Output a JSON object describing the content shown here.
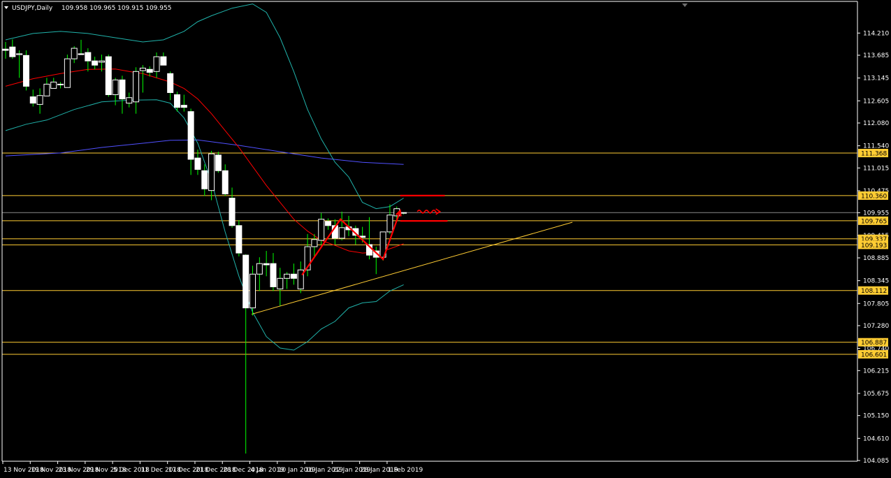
{
  "chart_data": {
    "type": "candlestick",
    "symbol": "USDJPY",
    "timeframe": "Daily",
    "header": {
      "text": "USDJPY,Daily",
      "ohlc": "109.958 109.965 109.915 109.955"
    },
    "ylim": [
      104.085,
      114.48
    ],
    "yticks": [
      "114.210",
      "113.685",
      "113.145",
      "112.605",
      "112.080",
      "111.540",
      "111.015",
      "110.475",
      "109.955",
      "109.415",
      "108.885",
      "108.345",
      "107.805",
      "107.280",
      "106.740",
      "106.215",
      "105.675",
      "105.150",
      "104.610",
      "104.085"
    ],
    "xticks": [
      {
        "i": 0,
        "label": "13 Nov 2018"
      },
      {
        "i": 4,
        "label": "19 Nov 2018"
      },
      {
        "i": 8,
        "label": "23 Nov 2018"
      },
      {
        "i": 12,
        "label": "29 Nov 2018"
      },
      {
        "i": 16,
        "label": "5 Dec 2018"
      },
      {
        "i": 20,
        "label": "11 Dec 2018"
      },
      {
        "i": 24,
        "label": "17 Dec 2018"
      },
      {
        "i": 28,
        "label": "21 Dec 2018"
      },
      {
        "i": 32,
        "label": "28 Dec 2018"
      },
      {
        "i": 36,
        "label": "4 Jan 2019"
      },
      {
        "i": 40,
        "label": "10 Jan 2019"
      },
      {
        "i": 44,
        "label": "16 Jan 2019"
      },
      {
        "i": 48,
        "label": "22 Jan 2019"
      },
      {
        "i": 52,
        "label": "28 Jan 2019"
      },
      {
        "i": 56,
        "label": "1 Feb 2019"
      }
    ],
    "candles": [
      {
        "o": 113.83,
        "h": 114.0,
        "l": 113.6,
        "c": 113.8
      },
      {
        "o": 113.88,
        "h": 114.06,
        "l": 113.6,
        "c": 113.65
      },
      {
        "o": 113.7,
        "h": 113.8,
        "l": 113.15,
        "c": 113.72
      },
      {
        "o": 113.68,
        "h": 113.8,
        "l": 112.85,
        "c": 112.95
      },
      {
        "o": 112.7,
        "h": 112.87,
        "l": 112.47,
        "c": 112.55
      },
      {
        "o": 112.52,
        "h": 112.9,
        "l": 112.3,
        "c": 112.73
      },
      {
        "o": 112.72,
        "h": 113.15,
        "l": 112.72,
        "c": 113.0
      },
      {
        "o": 112.9,
        "h": 113.15,
        "l": 112.9,
        "c": 113.05
      },
      {
        "o": 113.0,
        "h": 113.05,
        "l": 112.9,
        "c": 113.0
      },
      {
        "o": 112.92,
        "h": 113.7,
        "l": 112.92,
        "c": 113.6
      },
      {
        "o": 113.6,
        "h": 113.9,
        "l": 113.5,
        "c": 113.85
      },
      {
        "o": 113.72,
        "h": 114.05,
        "l": 113.7,
        "c": 113.7
      },
      {
        "o": 113.75,
        "h": 113.85,
        "l": 113.3,
        "c": 113.55
      },
      {
        "o": 113.55,
        "h": 113.65,
        "l": 113.35,
        "c": 113.45
      },
      {
        "o": 113.52,
        "h": 113.7,
        "l": 113.3,
        "c": 113.55
      },
      {
        "o": 113.65,
        "h": 113.7,
        "l": 112.7,
        "c": 112.75
      },
      {
        "o": 112.75,
        "h": 113.15,
        "l": 112.5,
        "c": 113.1
      },
      {
        "o": 113.1,
        "h": 113.2,
        "l": 112.3,
        "c": 112.65
      },
      {
        "o": 112.55,
        "h": 112.8,
        "l": 112.45,
        "c": 112.68
      },
      {
        "o": 112.58,
        "h": 113.4,
        "l": 112.3,
        "c": 113.3
      },
      {
        "o": 113.32,
        "h": 113.45,
        "l": 112.8,
        "c": 113.38
      },
      {
        "o": 113.35,
        "h": 113.42,
        "l": 113.18,
        "c": 113.28
      },
      {
        "o": 113.3,
        "h": 113.75,
        "l": 113.15,
        "c": 113.65
      },
      {
        "o": 113.65,
        "h": 113.75,
        "l": 113.45,
        "c": 113.45
      },
      {
        "o": 113.25,
        "h": 113.3,
        "l": 112.62,
        "c": 112.8
      },
      {
        "o": 112.75,
        "h": 112.82,
        "l": 112.35,
        "c": 112.45
      },
      {
        "o": 112.5,
        "h": 112.75,
        "l": 112.35,
        "c": 112.45
      },
      {
        "o": 112.35,
        "h": 112.42,
        "l": 110.85,
        "c": 111.22
      },
      {
        "o": 111.25,
        "h": 111.45,
        "l": 110.85,
        "c": 110.98
      },
      {
        "o": 110.95,
        "h": 111.1,
        "l": 110.35,
        "c": 110.52
      },
      {
        "o": 110.48,
        "h": 111.42,
        "l": 110.25,
        "c": 111.35
      },
      {
        "o": 111.32,
        "h": 111.4,
        "l": 110.9,
        "c": 110.95
      },
      {
        "o": 110.95,
        "h": 111.1,
        "l": 110.35,
        "c": 110.4
      },
      {
        "o": 110.3,
        "h": 110.55,
        "l": 109.6,
        "c": 109.65
      },
      {
        "o": 109.65,
        "h": 109.78,
        "l": 108.92,
        "c": 109.0
      },
      {
        "o": 108.95,
        "h": 108.97,
        "l": 104.25,
        "c": 107.7
      },
      {
        "o": 107.7,
        "h": 108.7,
        "l": 107.52,
        "c": 108.5
      },
      {
        "o": 108.5,
        "h": 108.9,
        "l": 108.1,
        "c": 108.75
      },
      {
        "o": 108.75,
        "h": 109.05,
        "l": 108.45,
        "c": 108.72
      },
      {
        "o": 108.75,
        "h": 109.0,
        "l": 108.1,
        "c": 108.2
      },
      {
        "o": 108.15,
        "h": 108.65,
        "l": 107.75,
        "c": 108.4
      },
      {
        "o": 108.4,
        "h": 108.55,
        "l": 108.15,
        "c": 108.5
      },
      {
        "o": 108.5,
        "h": 108.75,
        "l": 108.25,
        "c": 108.4
      },
      {
        "o": 108.15,
        "h": 108.8,
        "l": 108.05,
        "c": 108.6
      },
      {
        "o": 108.6,
        "h": 109.45,
        "l": 108.45,
        "c": 109.15
      },
      {
        "o": 109.15,
        "h": 109.45,
        "l": 108.9,
        "c": 109.32
      },
      {
        "o": 109.3,
        "h": 109.95,
        "l": 109.2,
        "c": 109.8
      },
      {
        "o": 109.75,
        "h": 109.82,
        "l": 109.55,
        "c": 109.65
      },
      {
        "o": 109.65,
        "h": 109.8,
        "l": 109.2,
        "c": 109.35
      },
      {
        "o": 109.35,
        "h": 109.98,
        "l": 109.3,
        "c": 109.6
      },
      {
        "o": 109.62,
        "h": 109.88,
        "l": 109.4,
        "c": 109.55
      },
      {
        "o": 109.58,
        "h": 109.65,
        "l": 109.2,
        "c": 109.42
      },
      {
        "o": 109.4,
        "h": 109.62,
        "l": 109.25,
        "c": 109.37
      },
      {
        "o": 109.2,
        "h": 109.85,
        "l": 108.85,
        "c": 108.95
      },
      {
        "o": 109.05,
        "h": 109.15,
        "l": 108.5,
        "c": 108.9
      },
      {
        "o": 108.9,
        "h": 109.5,
        "l": 108.82,
        "c": 109.5
      },
      {
        "o": 109.5,
        "h": 110.15,
        "l": 109.45,
        "c": 109.9
      },
      {
        "o": 109.88,
        "h": 110.1,
        "l": 109.75,
        "c": 110.05
      },
      {
        "o": 109.958,
        "h": 109.965,
        "l": 109.915,
        "c": 109.955
      }
    ],
    "upper_band": [
      {
        "i": 0,
        "v": 114.05
      },
      {
        "i": 4,
        "v": 114.2
      },
      {
        "i": 8,
        "v": 114.25
      },
      {
        "i": 12,
        "v": 114.2
      },
      {
        "i": 16,
        "v": 114.1
      },
      {
        "i": 20,
        "v": 114.0
      },
      {
        "i": 23,
        "v": 114.05
      },
      {
        "i": 26,
        "v": 114.25
      },
      {
        "i": 28,
        "v": 114.48
      },
      {
        "i": 30,
        "v": 114.62
      },
      {
        "i": 33,
        "v": 114.8
      },
      {
        "i": 36,
        "v": 114.9
      },
      {
        "i": 38,
        "v": 114.7
      },
      {
        "i": 40,
        "v": 114.1
      },
      {
        "i": 42,
        "v": 113.3
      },
      {
        "i": 44,
        "v": 112.4
      },
      {
        "i": 46,
        "v": 111.7
      },
      {
        "i": 48,
        "v": 111.15
      },
      {
        "i": 50,
        "v": 110.8
      },
      {
        "i": 52,
        "v": 110.2
      },
      {
        "i": 54,
        "v": 110.05
      },
      {
        "i": 56,
        "v": 110.1
      },
      {
        "i": 58,
        "v": 110.3
      }
    ],
    "lower_band": [
      {
        "i": 0,
        "v": 111.9
      },
      {
        "i": 3,
        "v": 112.05
      },
      {
        "i": 6,
        "v": 112.15
      },
      {
        "i": 10,
        "v": 112.4
      },
      {
        "i": 14,
        "v": 112.58
      },
      {
        "i": 18,
        "v": 112.62
      },
      {
        "i": 22,
        "v": 112.63
      },
      {
        "i": 24,
        "v": 112.55
      },
      {
        "i": 26,
        "v": 112.2
      },
      {
        "i": 28,
        "v": 111.6
      },
      {
        "i": 30,
        "v": 110.7
      },
      {
        "i": 32,
        "v": 109.5
      },
      {
        "i": 34,
        "v": 108.45
      },
      {
        "i": 36,
        "v": 107.6
      },
      {
        "i": 38,
        "v": 107.02
      },
      {
        "i": 40,
        "v": 106.75
      },
      {
        "i": 42,
        "v": 106.7
      },
      {
        "i": 44,
        "v": 106.9
      },
      {
        "i": 46,
        "v": 107.2
      },
      {
        "i": 48,
        "v": 107.38
      },
      {
        "i": 50,
        "v": 107.7
      },
      {
        "i": 52,
        "v": 107.82
      },
      {
        "i": 54,
        "v": 107.85
      },
      {
        "i": 56,
        "v": 108.1
      },
      {
        "i": 58,
        "v": 108.25
      }
    ],
    "ma_red": [
      {
        "i": 0,
        "v": 112.95
      },
      {
        "i": 4,
        "v": 113.13
      },
      {
        "i": 8,
        "v": 113.25
      },
      {
        "i": 12,
        "v": 113.35
      },
      {
        "i": 16,
        "v": 113.36
      },
      {
        "i": 18,
        "v": 113.3
      },
      {
        "i": 20,
        "v": 113.25
      },
      {
        "i": 22,
        "v": 113.15
      },
      {
        "i": 24,
        "v": 113.05
      },
      {
        "i": 26,
        "v": 112.9
      },
      {
        "i": 28,
        "v": 112.65
      },
      {
        "i": 30,
        "v": 112.3
      },
      {
        "i": 32,
        "v": 111.9
      },
      {
        "i": 34,
        "v": 111.5
      },
      {
        "i": 36,
        "v": 111.05
      },
      {
        "i": 38,
        "v": 110.6
      },
      {
        "i": 40,
        "v": 110.2
      },
      {
        "i": 42,
        "v": 109.8
      },
      {
        "i": 44,
        "v": 109.52
      },
      {
        "i": 46,
        "v": 109.3
      },
      {
        "i": 48,
        "v": 109.18
      },
      {
        "i": 50,
        "v": 109.05
      },
      {
        "i": 52,
        "v": 109.0
      },
      {
        "i": 54,
        "v": 109.02
      },
      {
        "i": 56,
        "v": 109.1
      },
      {
        "i": 58,
        "v": 109.22
      }
    ],
    "ma_blue": [
      {
        "i": 0,
        "v": 111.3
      },
      {
        "i": 8,
        "v": 111.37
      },
      {
        "i": 14,
        "v": 111.5
      },
      {
        "i": 20,
        "v": 111.6
      },
      {
        "i": 24,
        "v": 111.67
      },
      {
        "i": 28,
        "v": 111.68
      },
      {
        "i": 34,
        "v": 111.55
      },
      {
        "i": 40,
        "v": 111.4
      },
      {
        "i": 46,
        "v": 111.25
      },
      {
        "i": 52,
        "v": 111.15
      },
      {
        "i": 58,
        "v": 111.1
      }
    ],
    "horizontal_levels": [
      {
        "value": 111.368,
        "label": "111.368"
      },
      {
        "value": 110.36,
        "label": "110.360"
      },
      {
        "value": 109.958,
        "label": ""
      },
      {
        "value": 109.765,
        "label": "109.765"
      },
      {
        "value": 109.337,
        "label": "109.337"
      },
      {
        "value": 109.193,
        "label": "109.193"
      },
      {
        "value": 108.112,
        "label": "108.112"
      },
      {
        "value": 106.887,
        "label": "106.887"
      },
      {
        "value": 106.601,
        "label": "106.601"
      }
    ],
    "trendline": {
      "x1": 35.85,
      "y1": 107.55,
      "x2": 82.6,
      "y2": 109.73
    },
    "red_zigzag": [
      {
        "i": 43.2,
        "v": 108.48
      },
      {
        "i": 48.8,
        "v": 109.8
      },
      {
        "i": 55.0,
        "v": 108.85
      },
      {
        "i": 57.5,
        "v": 110.0
      }
    ],
    "red_hlines": [
      {
        "i1": 57.5,
        "i2": 64.0,
        "v": 110.36
      },
      {
        "i1": 57.5,
        "i2": 64.4,
        "v": 109.76
      }
    ],
    "red_squiggle": {
      "i1": 60.0,
      "i2": 63.2,
      "v": 109.98
    },
    "colors": {
      "background": "#000000",
      "bull_body": "#ffffff",
      "bear_body": "#ffffff",
      "wick": "#00ff00",
      "band": "#20b2aa",
      "ma_red": "#ff0000",
      "ma_blue": "#5050ff",
      "level": "#ffcc33",
      "label_bg": "#ffcc33",
      "axis": "#ffffff",
      "annotation": "#ff0000"
    }
  }
}
